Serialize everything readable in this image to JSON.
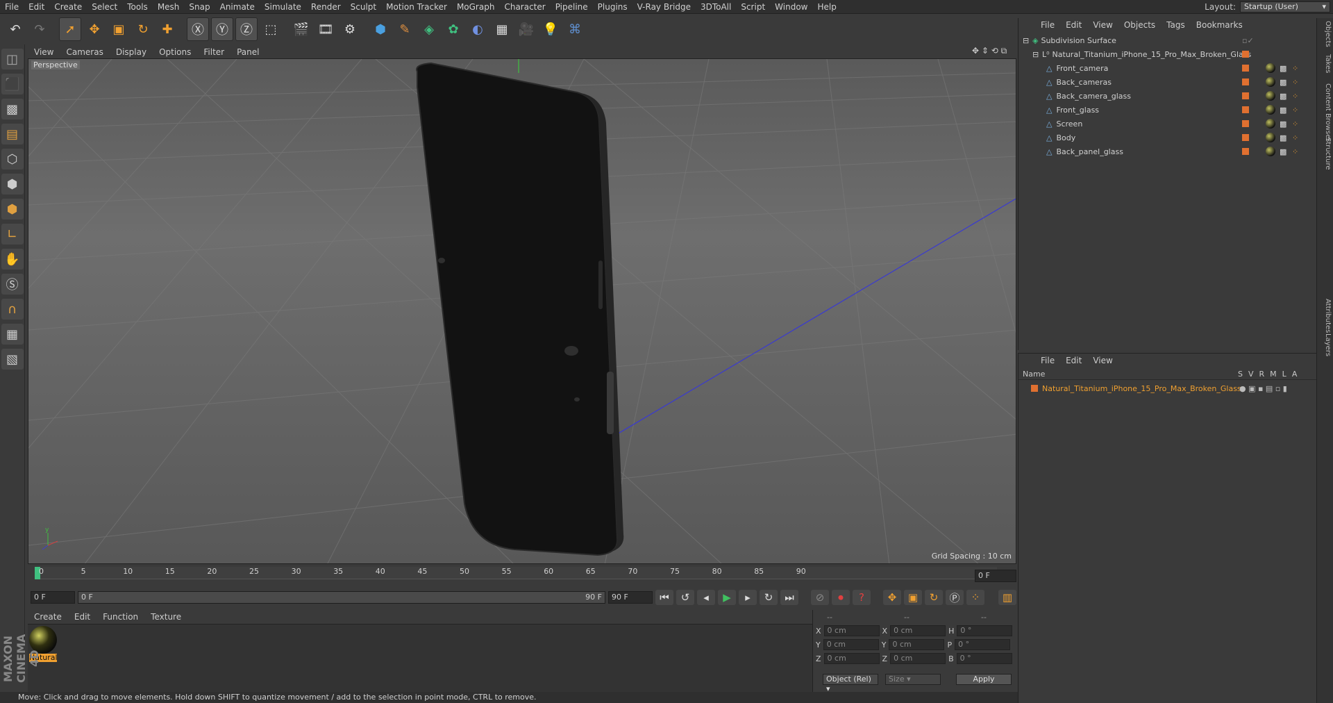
{
  "menubar": {
    "items": [
      "File",
      "Edit",
      "Create",
      "Select",
      "Tools",
      "Mesh",
      "Snap",
      "Animate",
      "Simulate",
      "Render",
      "Sculpt",
      "Motion Tracker",
      "MoGraph",
      "Character",
      "Pipeline",
      "Plugins",
      "V-Ray Bridge",
      "3DToAll",
      "Script",
      "Window",
      "Help"
    ],
    "layout_label": "Layout:",
    "layout_value": "Startup (User)"
  },
  "viewport": {
    "menu": [
      "View",
      "Cameras",
      "Display",
      "Options",
      "Filter",
      "Panel"
    ],
    "label": "Perspective",
    "grid_spacing": "Grid Spacing : 10 cm"
  },
  "timeline": {
    "ticks": [
      "0",
      "5",
      "10",
      "15",
      "20",
      "25",
      "30",
      "35",
      "40",
      "45",
      "50",
      "55",
      "60",
      "65",
      "70",
      "75",
      "80",
      "85",
      "90"
    ],
    "current_frame": "0 F",
    "start_field": "0 F",
    "range_start": "0 F",
    "range_end": "90 F",
    "end_field": "90 F"
  },
  "material_manager": {
    "menu": [
      "Create",
      "Edit",
      "Function",
      "Texture"
    ],
    "material_name": "Natural"
  },
  "coordinates": {
    "header": [
      "--",
      "--",
      "--"
    ],
    "rows": [
      {
        "a": "X",
        "av": "0 cm",
        "b": "X",
        "bv": "0 cm",
        "c": "H",
        "cv": "0 °"
      },
      {
        "a": "Y",
        "av": "0 cm",
        "b": "Y",
        "bv": "0 cm",
        "c": "P",
        "cv": "0 °"
      },
      {
        "a": "Z",
        "av": "0 cm",
        "b": "Z",
        "bv": "0 cm",
        "c": "B",
        "cv": "0 °"
      }
    ],
    "mode": "Object (Rel)",
    "size": "Size",
    "apply": "Apply"
  },
  "object_manager": {
    "menu": [
      "File",
      "Edit",
      "View",
      "Objects",
      "Tags",
      "Bookmarks"
    ],
    "root": "Subdivision Surface",
    "group": "Natural_Titanium_iPhone_15_Pro_Max_Broken_Glass",
    "children": [
      "Front_camera",
      "Back_cameras",
      "Back_camera_glass",
      "Front_glass",
      "Screen",
      "Body",
      "Back_panel_glass"
    ]
  },
  "layer_manager": {
    "menu": [
      "File",
      "Edit",
      "View"
    ],
    "name_header": "Name",
    "cols": [
      "S",
      "V",
      "R",
      "M",
      "L",
      "A"
    ],
    "layer": "Natural_Titanium_iPhone_15_Pro_Max_Broken_Glass"
  },
  "side_tabs": [
    "Objects",
    "Takes",
    "Content Browser",
    "Structure",
    "Attributes",
    "Layers"
  ],
  "status": "Move: Click and drag to move elements. Hold down SHIFT to quantize movement / add to the selection in point mode, CTRL to remove.",
  "brand": "MAXON CINEMA 4D",
  "colors": {
    "accent": "#e8a030",
    "selection": "#f0a030",
    "axis_blue": "#3a3ad0",
    "layer_orange": "#e07030"
  }
}
